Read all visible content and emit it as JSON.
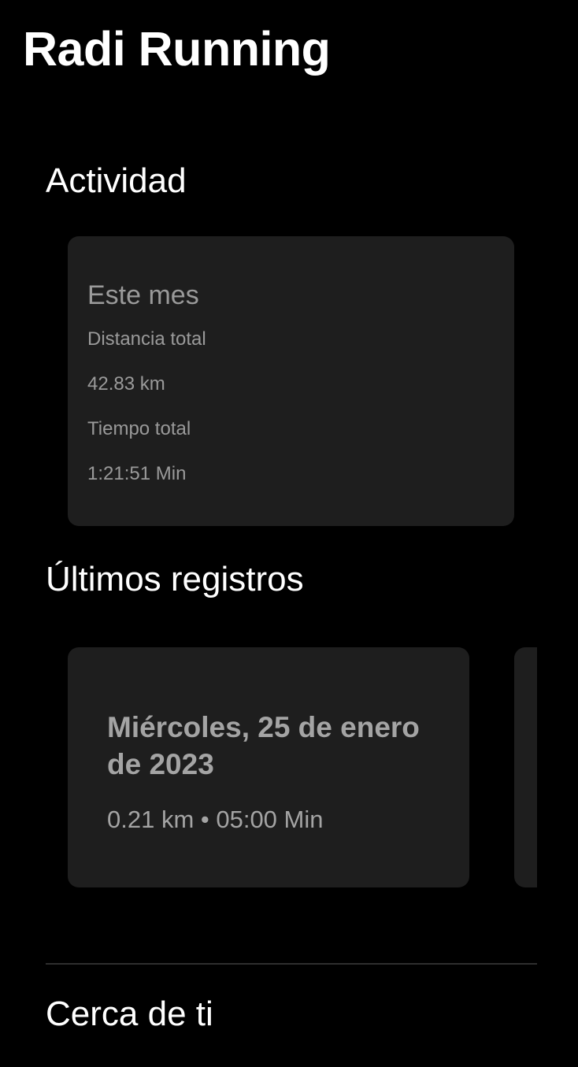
{
  "header": {
    "title": "Radi Running"
  },
  "activity": {
    "section_title": "Actividad",
    "card": {
      "heading": "Este mes",
      "distance_label": "Distancia total",
      "distance_value": "42.83 km",
      "time_label": "Tiempo total",
      "time_value": "1:21:51 Min"
    }
  },
  "records": {
    "section_title": "Últimos registros",
    "items": [
      {
        "date": "Miércoles, 25 de enero de 2023",
        "summary": "0.21 km • 05:00 Min"
      }
    ]
  },
  "nearby": {
    "section_title": "Cerca de ti"
  },
  "colors": {
    "background": "#000000",
    "card": "#1e1e1e",
    "muted_text": "#9a9a9a",
    "divider": "#2e2e2e"
  }
}
